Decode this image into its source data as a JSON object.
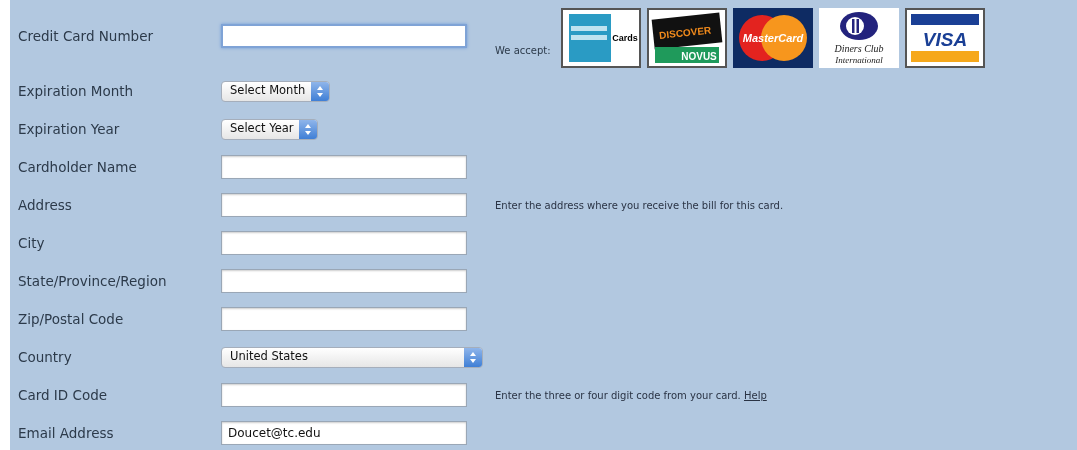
{
  "accept_label": "We accept:",
  "card_logos": [
    {
      "kind": "amex",
      "texts": [
        "Cards"
      ]
    },
    {
      "kind": "discover",
      "texts": [
        "DISCOVER",
        "NOVUS"
      ]
    },
    {
      "kind": "mastercard",
      "texts": [
        "MasterCard"
      ]
    },
    {
      "kind": "diners",
      "texts": [
        "Diners Club",
        "International"
      ]
    },
    {
      "kind": "visa",
      "texts": [
        "VISA"
      ]
    }
  ],
  "fields": [
    {
      "label": "Credit Card Number",
      "kind": "text",
      "focused": true
    },
    {
      "label": "Expiration Month",
      "kind": "select",
      "value": "Select Month",
      "wide": false
    },
    {
      "label": "Expiration Year",
      "kind": "select",
      "value": "Select Year",
      "wide": false
    },
    {
      "label": "Cardholder Name",
      "kind": "text",
      "focused": false
    },
    {
      "label": "Address",
      "kind": "text",
      "focused": false,
      "hint": "Enter the address where you receive the bill for this card."
    },
    {
      "label": "City",
      "kind": "text",
      "focused": false
    },
    {
      "label": "State/Province/Region",
      "kind": "text",
      "focused": false
    },
    {
      "label": "Zip/Postal Code",
      "kind": "text",
      "focused": false
    },
    {
      "label": "Country",
      "kind": "select",
      "value": "United States",
      "wide": true
    },
    {
      "label": "Card ID Code",
      "kind": "text",
      "focused": false,
      "hint": "Enter the three or four digit code from your card.",
      "hint_link": "Help"
    },
    {
      "label": "Email Address",
      "kind": "text",
      "value": "Doucet@tc.edu",
      "focused": false
    }
  ]
}
